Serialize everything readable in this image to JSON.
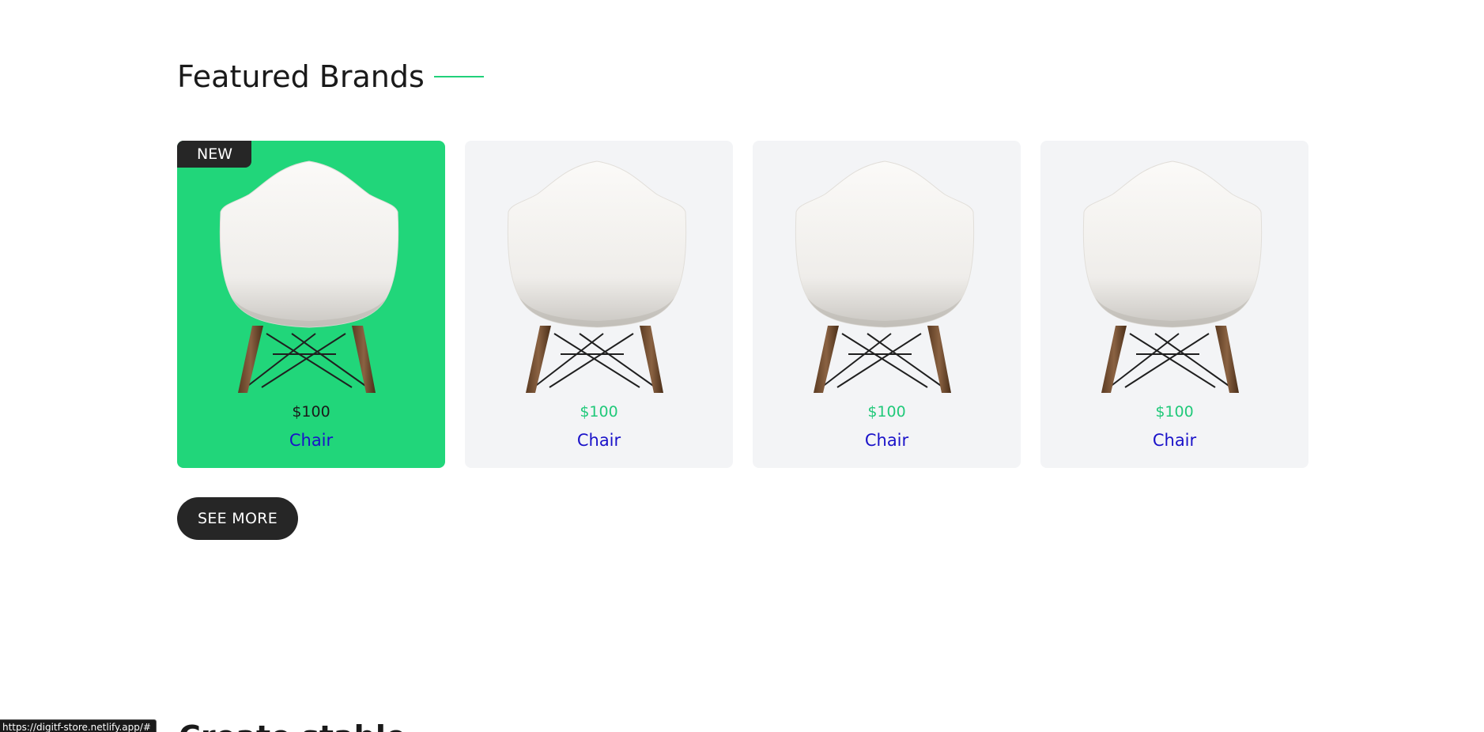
{
  "section": {
    "title": "Featured Brands",
    "accent_color": "#21d07a"
  },
  "products": [
    {
      "badge": "NEW",
      "price": "$100",
      "name": "Chair",
      "active": true
    },
    {
      "badge": "",
      "price": "$100",
      "name": "Chair",
      "active": false
    },
    {
      "badge": "",
      "price": "$100",
      "name": "Chair",
      "active": false
    },
    {
      "badge": "",
      "price": "$100",
      "name": "Chair",
      "active": false
    }
  ],
  "see_more_label": "SEE MORE",
  "next_section_title": "Create stable",
  "status_bar_url": "https://digitf-store.netlify.app/#",
  "colors": {
    "active_card": "#21d67a",
    "card_bg": "#f3f4f6",
    "price_green": "#21c97a",
    "link_blue": "#1a12c9",
    "dark": "#262626"
  }
}
